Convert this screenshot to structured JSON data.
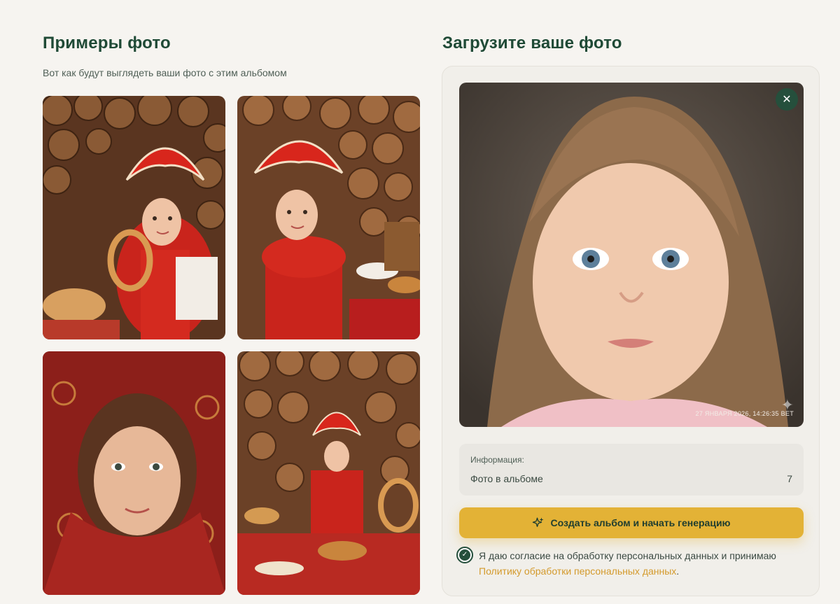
{
  "examples": {
    "title": "Примеры фото",
    "subtitle": "Вот как будут выглядеть ваши фото с этим альбомом"
  },
  "upload": {
    "title": "Загрузите ваше фото",
    "close_icon": "close-icon",
    "timestamp": "27 ЯНВАРЯ 2026, 14:26:35 ВЕТ",
    "info_label": "Информация:",
    "info_row_label": "Фото в альбоме",
    "info_row_value": "7",
    "create_button": "Создать альбом и начать генерацию",
    "consent_text": "Я даю согласие на обработку персональных данных и принимаю",
    "consent_link": "Политику обработки персональных данных",
    "consent_dot": "."
  },
  "colors": {
    "accent_green": "#254f3c",
    "title_green": "#1f4a36",
    "button_yellow": "#e3b236",
    "link_orange": "#d49a2c"
  }
}
